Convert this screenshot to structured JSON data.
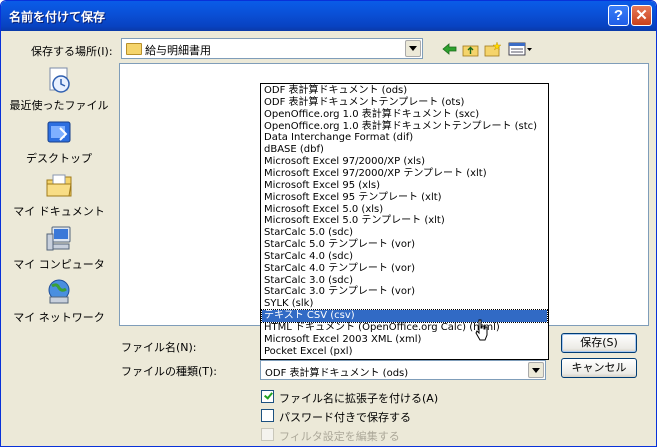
{
  "window": {
    "title": "名前を付けて保存",
    "help_glyph": "?",
    "close_glyph": "✕"
  },
  "location": {
    "label": "保存する場所(I):",
    "value": "給与明細書用"
  },
  "places": [
    {
      "label": "最近使ったファイル",
      "icon": "recent-documents-icon"
    },
    {
      "label": "デスクトップ",
      "icon": "desktop-icon"
    },
    {
      "label": "マイ ドキュメント",
      "icon": "my-documents-icon"
    },
    {
      "label": "マイ コンピュータ",
      "icon": "my-computer-icon"
    },
    {
      "label": "マイ ネットワーク",
      "icon": "my-network-icon"
    }
  ],
  "filename": {
    "label": "ファイル名(N):"
  },
  "filetype": {
    "label": "ファイルの種類(T):",
    "value": "ODF 表計算ドキュメント (ods)",
    "options": [
      "ODF 表計算ドキュメント (ods)",
      "ODF 表計算ドキュメントテンプレート (ots)",
      "OpenOffice.org 1.0 表計算ドキュメント (sxc)",
      "OpenOffice.org 1.0 表計算ドキュメントテンプレート (stc)",
      "Data Interchange Format (dif)",
      "dBASE (dbf)",
      "Microsoft Excel 97/2000/XP (xls)",
      "Microsoft Excel 97/2000/XP テンプレート (xlt)",
      "Microsoft Excel 95 (xls)",
      "Microsoft Excel 95 テンプレート (xlt)",
      "Microsoft Excel 5.0 (xls)",
      "Microsoft Excel 5.0 テンプレート (xlt)",
      "StarCalc 5.0 (sdc)",
      "StarCalc 5.0 テンプレート (vor)",
      "StarCalc 4.0 (sdc)",
      "StarCalc 4.0 テンプレート (vor)",
      "StarCalc 3.0 (sdc)",
      "StarCalc 3.0 テンプレート (vor)",
      "SYLK (slk)",
      "テキスト CSV (csv)",
      "HTML ドキュメント (OpenOffice.org Calc) (html)",
      "Microsoft Excel 2003 XML (xml)",
      "Pocket Excel (pxl)"
    ],
    "highlighted_index": 19
  },
  "buttons": {
    "save": "保存(S)",
    "cancel": "キャンセル"
  },
  "options": {
    "auto_extension": {
      "label": "ファイル名に拡張子を付ける(A)",
      "checked": true
    },
    "password": {
      "label": "パスワード付きで保存する",
      "checked": false
    },
    "filter_settings": {
      "label": "フィルタ設定を編集する",
      "checked": false,
      "disabled": true
    }
  },
  "colors": {
    "title_blue": "#0a4fd6",
    "dialog_bg": "#ece9d8",
    "selection": "#316ac5"
  }
}
